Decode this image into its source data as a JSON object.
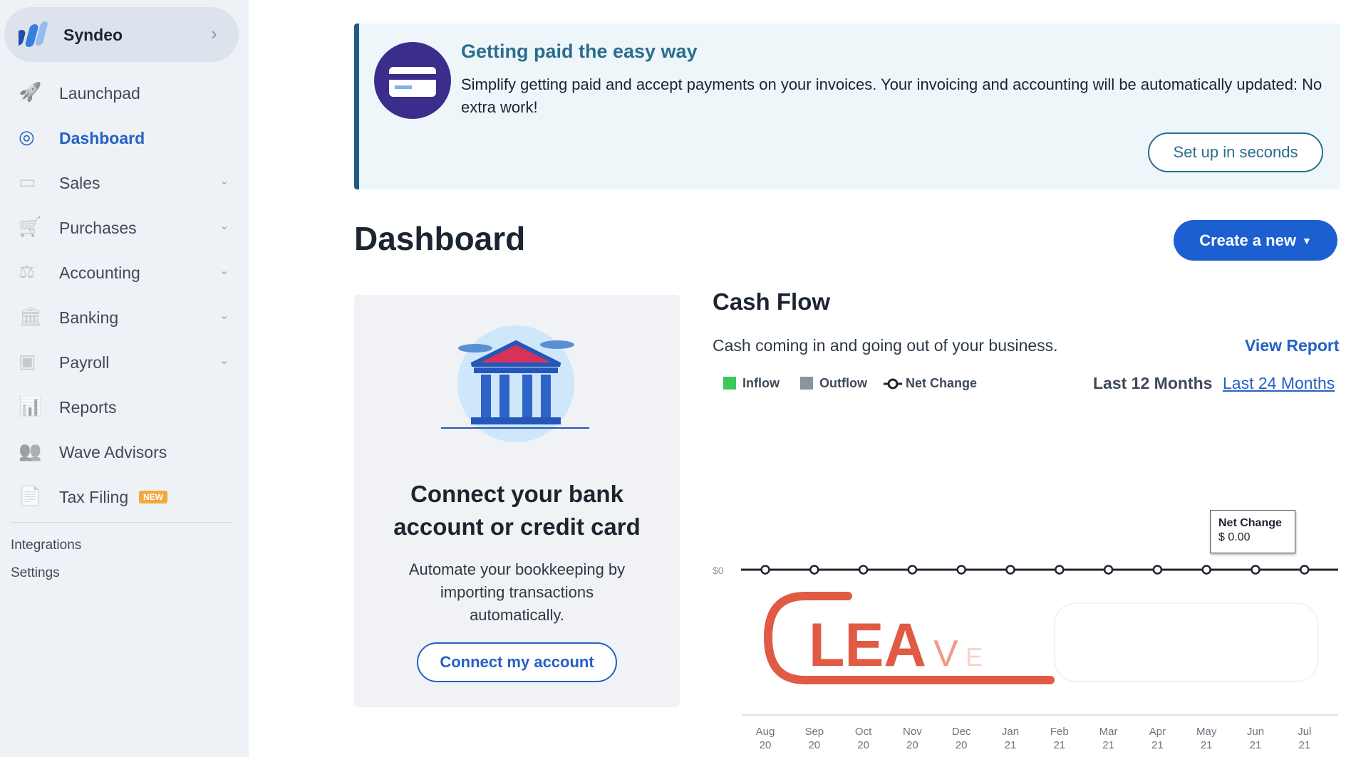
{
  "sidebar": {
    "business_name": "Syndeo",
    "items": [
      {
        "label": "Launchpad",
        "icon": "rocket-icon"
      },
      {
        "label": "Dashboard",
        "icon": "dashboard-gauge-icon",
        "active": true
      },
      {
        "label": "Sales",
        "icon": "credit-card-icon",
        "expandable": true
      },
      {
        "label": "Purchases",
        "icon": "cart-icon",
        "expandable": true
      },
      {
        "label": "Accounting",
        "icon": "scale-icon",
        "expandable": true
      },
      {
        "label": "Banking",
        "icon": "bank-icon",
        "expandable": true
      },
      {
        "label": "Payroll",
        "icon": "id-card-icon",
        "expandable": true
      },
      {
        "label": "Reports",
        "icon": "bar-chart-icon"
      },
      {
        "label": "Wave Advisors",
        "icon": "people-icon"
      },
      {
        "label": "Tax Filing",
        "icon": "tax-document-icon",
        "badge": "NEW"
      }
    ],
    "links": [
      "Integrations",
      "Settings"
    ]
  },
  "banner": {
    "title": "Getting paid the easy way",
    "body": "Simplify getting paid and accept payments on your invoices. Your invoicing and accounting will be automatically updated: No extra work!",
    "button": "Set up in seconds",
    "icon": "credit-card-icon"
  },
  "page_title": "Dashboard",
  "create_button": "Create a new",
  "bank_card": {
    "title": "Connect your bank account or credit card",
    "description": "Automate your bookkeeping by importing transactions automatically.",
    "button": "Connect my account"
  },
  "cash_flow": {
    "title": "Cash Flow",
    "subtitle": "Cash coming in and going out of your business.",
    "view_report": "View Report",
    "legend": [
      "Inflow",
      "Outflow",
      "Net Change"
    ],
    "ranges": [
      "Last 12 Months",
      "Last 24 Months"
    ],
    "tooltip": {
      "label": "Net Change",
      "value": "$ 0.00"
    },
    "colors": {
      "inflow": "#3cc85a",
      "outflow": "#8a939e",
      "net": "#1c2430"
    }
  },
  "chart_data": {
    "type": "line",
    "y_tick_label": "$0",
    "categories": [
      [
        "Aug",
        "20"
      ],
      [
        "Sep",
        "20"
      ],
      [
        "Oct",
        "20"
      ],
      [
        "Nov",
        "20"
      ],
      [
        "Dec",
        "20"
      ],
      [
        "Jan",
        "21"
      ],
      [
        "Feb",
        "21"
      ],
      [
        "Mar",
        "21"
      ],
      [
        "Apr",
        "21"
      ],
      [
        "May",
        "21"
      ],
      [
        "Jun",
        "21"
      ],
      [
        "Jul",
        "21"
      ]
    ],
    "series": [
      {
        "name": "Net Change",
        "values": [
          0,
          0,
          0,
          0,
          0,
          0,
          0,
          0,
          0,
          0,
          0,
          0
        ]
      }
    ]
  },
  "overlay_logo": {
    "text": "LEAVE",
    "color": "#e05a44"
  }
}
